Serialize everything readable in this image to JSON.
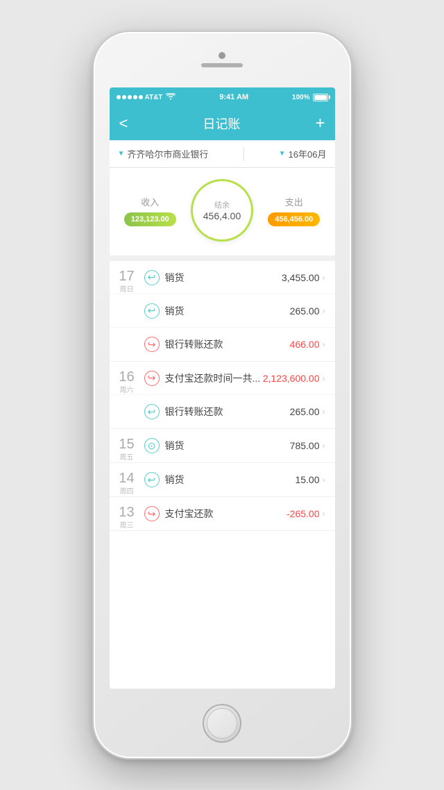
{
  "status": {
    "carrier": "AT&T",
    "time": "9:41 AM",
    "battery": "100%",
    "wifi": "wifi"
  },
  "nav": {
    "title": "日记账",
    "back": "<",
    "add": "+"
  },
  "filter": {
    "bank": "齐齐哈尔市商业银行",
    "period": "16年06月"
  },
  "summary": {
    "income_label": "收入",
    "expense_label": "支出",
    "balance_label": "结余",
    "income_amount": "123,123.00",
    "expense_amount": "456,456.00",
    "balance_amount": "456,4.00"
  },
  "transactions": [
    {
      "day": "17",
      "weekday": "周日",
      "items": [
        {
          "icon_type": "income",
          "name": "销货",
          "amount": "3,455.00",
          "amount_red": false
        },
        {
          "icon_type": "income",
          "name": "销货",
          "amount": "265.00",
          "amount_red": false
        },
        {
          "icon_type": "expense",
          "name": "银行转账还款",
          "amount": "466.00",
          "amount_red": true
        }
      ]
    },
    {
      "day": "16",
      "weekday": "周六",
      "items": [
        {
          "icon_type": "expense",
          "name": "支付宝还款时间一共...",
          "amount": "2,123,600.00",
          "amount_red": true
        },
        {
          "icon_type": "income",
          "name": "银行转账还款",
          "amount": "265.00",
          "amount_red": false
        }
      ]
    },
    {
      "day": "15",
      "weekday": "周五",
      "items": [
        {
          "icon_type": "transfer",
          "name": "销货",
          "amount": "785.00",
          "amount_red": false
        }
      ]
    },
    {
      "day": "14",
      "weekday": "周四",
      "items": [
        {
          "icon_type": "income",
          "name": "销货",
          "amount": "15.00",
          "amount_red": false
        }
      ]
    },
    {
      "day": "13",
      "weekday": "周三",
      "items": [
        {
          "icon_type": "expense",
          "name": "支付宝还款",
          "amount": "-265.00",
          "amount_red": true
        }
      ]
    }
  ]
}
